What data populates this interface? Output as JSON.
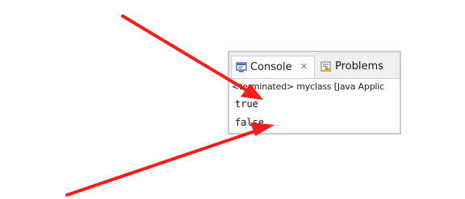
{
  "console_view": {
    "tabs": [
      {
        "label": "Console",
        "icon": "console-icon",
        "active": true
      },
      {
        "label": "Problems",
        "icon": "problems-icon",
        "active": false
      }
    ],
    "close_glyph": "✕",
    "status": "<terminated> myclass [Java Applic",
    "output_lines": [
      "true",
      "false"
    ]
  },
  "colors": {
    "annotation_arrow": "#ff1a1a",
    "panel_border": "#c9c9c9"
  }
}
